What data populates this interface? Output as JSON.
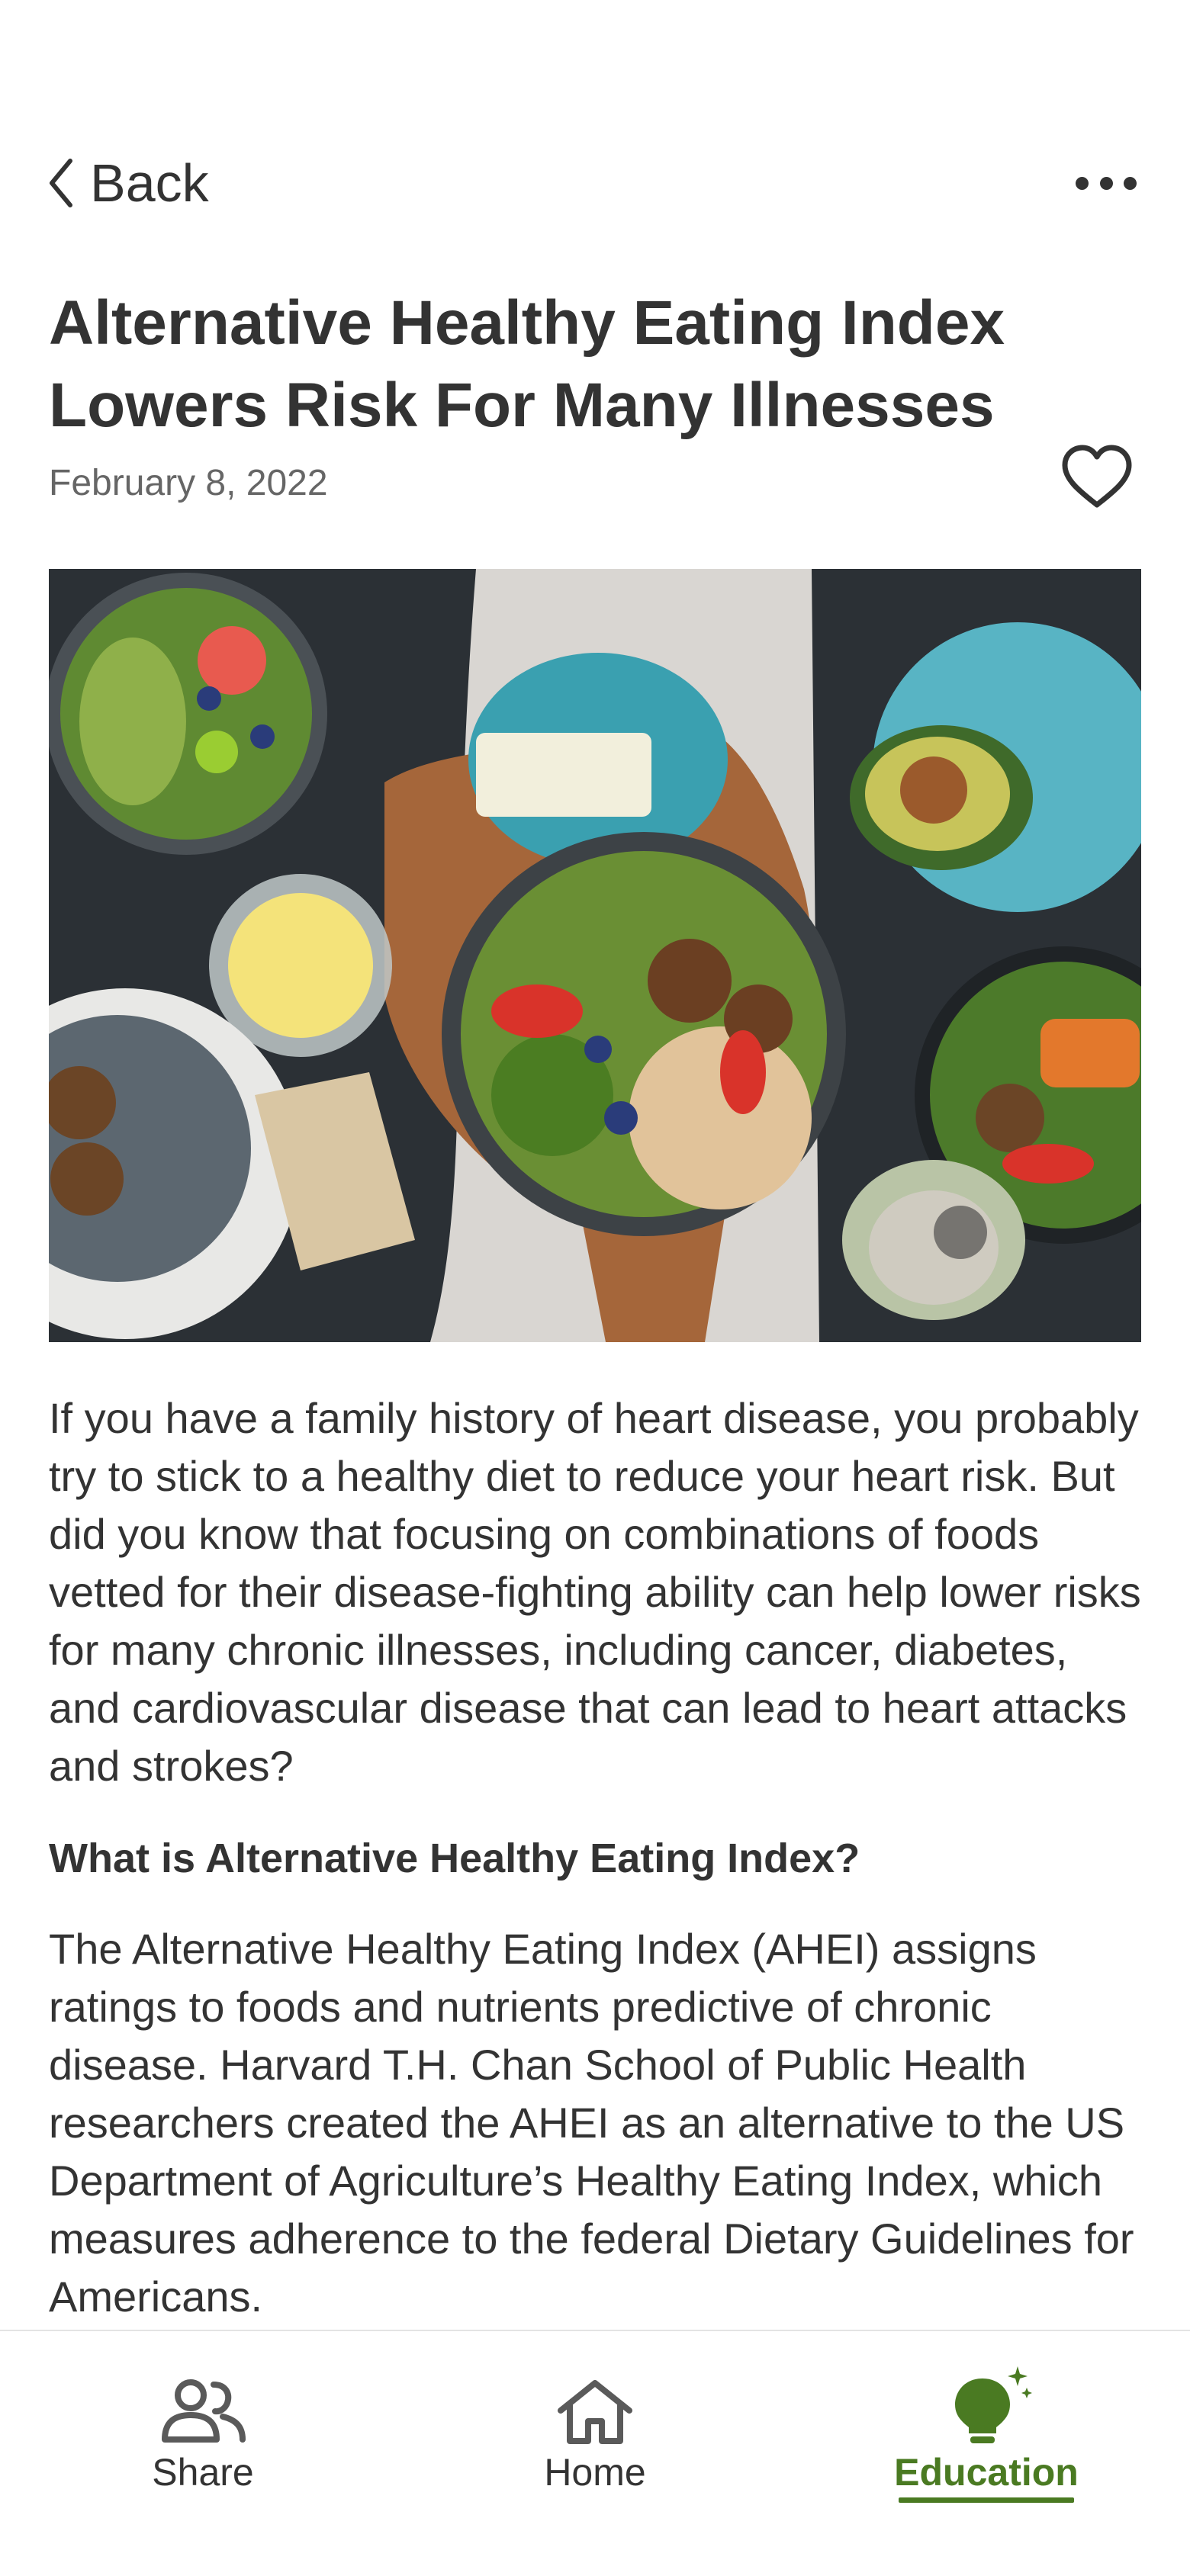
{
  "header": {
    "back_label": "Back"
  },
  "article": {
    "title": "Alternative Healthy Eating Index Lowers Risk For Many Illnesses",
    "date": "February 8, 2022",
    "intro": "If you have a family history of heart disease, you probably try to stick to a healthy diet to reduce your heart risk. But did you know that focusing on combinations of foods vetted for their disease-fighting ability can help lower risks for many chronic illnesses, including cancer, diabetes, and cardiovascular disease that can lead to heart attacks and strokes?",
    "section_heading": "What is Alternative Healthy Eating Index?",
    "section_body": "The Alternative Healthy Eating Index (AHEI) assigns ratings to foods and nutrients predictive of chronic disease. Harvard T.H. Chan School of Public Health researchers created the AHEI as an alternative to the US Department of Agriculture’s Healthy Eating Index, which measures adherence to the federal Dietary Guidelines for Americans."
  },
  "nav": {
    "items": [
      {
        "label": "Share",
        "icon": "people-icon",
        "active": false
      },
      {
        "label": "Home",
        "icon": "home-icon",
        "active": false
      },
      {
        "label": "Education",
        "icon": "lightbulb-icon",
        "active": true
      }
    ]
  },
  "colors": {
    "accent": "#4a7a22",
    "text": "#333333",
    "muted": "#666666"
  }
}
